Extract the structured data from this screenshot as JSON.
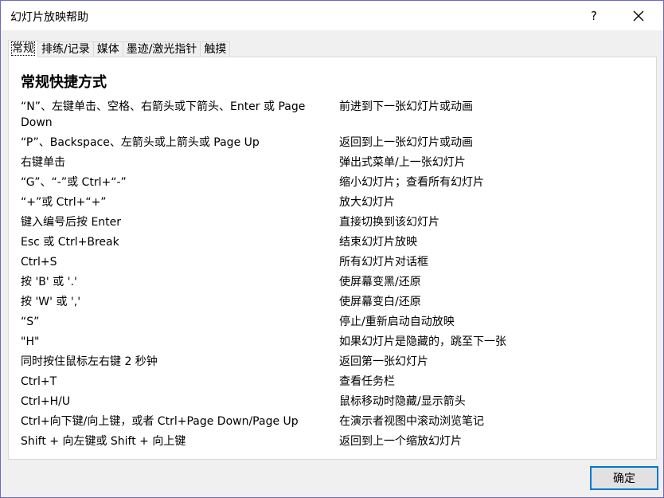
{
  "window": {
    "title": "幻灯片放映帮助",
    "help": "?"
  },
  "tabs": [
    {
      "label": "常规"
    },
    {
      "label": "排练/记录"
    },
    {
      "label": "媒体"
    },
    {
      "label": "墨迹/激光指针"
    },
    {
      "label": "触摸"
    }
  ],
  "panel": {
    "heading": "常规快捷方式",
    "rows": [
      {
        "key": "“N”、左键单击、空格、右箭头或下箭头、Enter 或 Page Down",
        "action": "前进到下一张幻灯片或动画"
      },
      {
        "key": "“P”、Backspace、左箭头或上箭头或 Page Up",
        "action": "返回到上一张幻灯片或动画"
      },
      {
        "key": "右键单击",
        "action": "弹出式菜单/上一张幻灯片"
      },
      {
        "key": "“G”、“-”或 Ctrl+“-”",
        "action": "缩小幻灯片；查看所有幻灯片"
      },
      {
        "key": "“+”或 Ctrl+“+”",
        "action": "放大幻灯片"
      },
      {
        "key": "键入编号后按 Enter",
        "action": "直接切换到该幻灯片"
      },
      {
        "key": "Esc 或 Ctrl+Break",
        "action": "结束幻灯片放映"
      },
      {
        "key": "Ctrl+S",
        "action": "所有幻灯片对话框"
      },
      {
        "key": "按 'B' 或 '.'",
        "action": "使屏幕变黑/还原"
      },
      {
        "key": "按 'W' 或 ','",
        "action": "使屏幕变白/还原"
      },
      {
        "key": "“S”",
        "action": "停止/重新启动自动放映"
      },
      {
        "key": "\"H\"",
        "action": "如果幻灯片是隐藏的，跳至下一张"
      },
      {
        "key": "同时按住鼠标左右键 2 秒钟",
        "action": "返回第一张幻灯片"
      },
      {
        "key": "Ctrl+T",
        "action": "查看任务栏"
      },
      {
        "key": "Ctrl+H/U",
        "action": "鼠标移动时隐藏/显示箭头"
      },
      {
        "key": "Ctrl+向下键/向上键，或者 Ctrl+Page Down/Page Up",
        "action": "在演示者视图中滚动浏览笔记"
      },
      {
        "key": "Shift + 向左键或 Shift + 向上键",
        "action": "返回到上一个缩放幻灯片"
      }
    ]
  },
  "buttons": {
    "ok": "确定"
  }
}
